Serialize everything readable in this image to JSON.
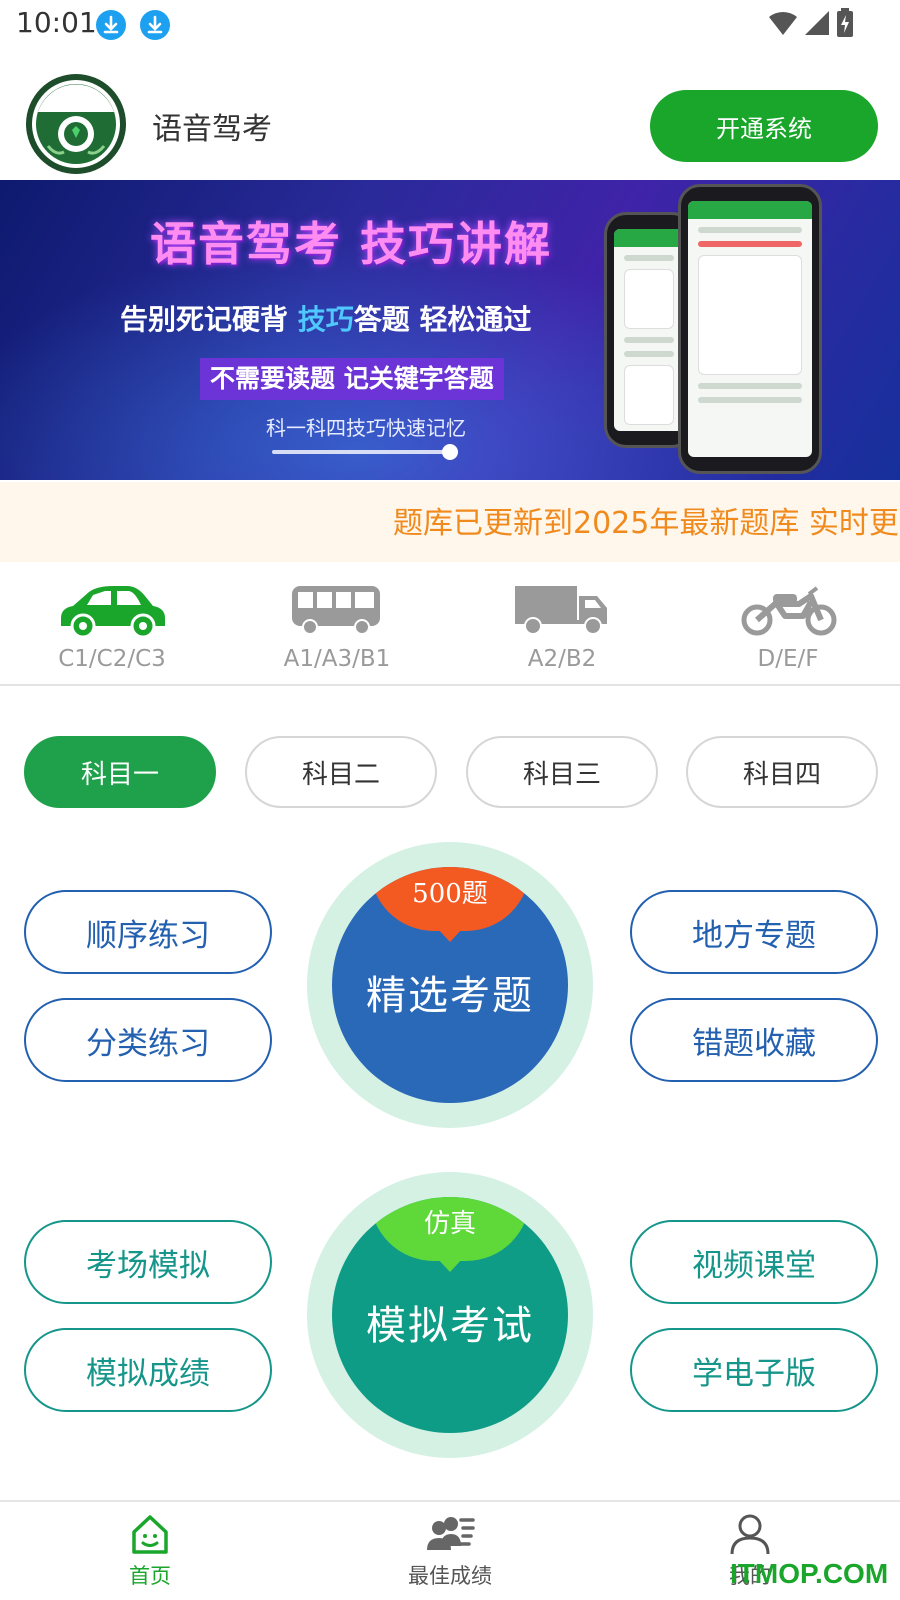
{
  "status_bar": {
    "time": "10:01"
  },
  "header": {
    "app_name": "语音驾考",
    "open_button": "开通系统",
    "logo_text": "语音驾考"
  },
  "banner": {
    "title": "语音驾考 技巧讲解",
    "subtitle_part1": "告别死记硬背 ",
    "subtitle_highlight": "技巧",
    "subtitle_part2": "答题 轻松通过",
    "tag": "不需要读题 记关键字答题",
    "caption": "科一科四技巧快速记忆"
  },
  "notice": {
    "text": "题库已更新到2025年最新题库 实时更"
  },
  "vehicles": [
    {
      "label": "C1/C2/C3",
      "icon": "car-icon",
      "active": true
    },
    {
      "label": "A1/A3/B1",
      "icon": "bus-icon",
      "active": false
    },
    {
      "label": "A2/B2",
      "icon": "truck-icon",
      "active": false
    },
    {
      "label": "D/E/F",
      "icon": "motorcycle-icon",
      "active": false
    }
  ],
  "subjects": [
    {
      "label": "科目一",
      "active": true
    },
    {
      "label": "科目二",
      "active": false
    },
    {
      "label": "科目三",
      "active": false
    },
    {
      "label": "科目四",
      "active": false
    }
  ],
  "practice": {
    "left": [
      "顺序练习",
      "分类练习"
    ],
    "right": [
      "地方专题",
      "错题收藏"
    ],
    "center": {
      "badge": "500题",
      "label": "精选考题"
    }
  },
  "exam": {
    "left": [
      "考场模拟",
      "模拟成绩"
    ],
    "right": [
      "视频课堂",
      "学电子版"
    ],
    "center": {
      "badge": "仿真",
      "label": "模拟考试"
    }
  },
  "bottom_nav": [
    {
      "label": "首页",
      "icon": "home-icon",
      "active": true
    },
    {
      "label": "最佳成绩",
      "icon": "ranking-icon",
      "active": false
    },
    {
      "label": "我的",
      "icon": "user-icon",
      "active": false
    }
  ],
  "watermark": "ITMOP.COM",
  "colors": {
    "primary_green": "#1aa52b",
    "blue": "#2460b0",
    "teal": "#16968a",
    "notice_orange": "#f08a1c"
  }
}
